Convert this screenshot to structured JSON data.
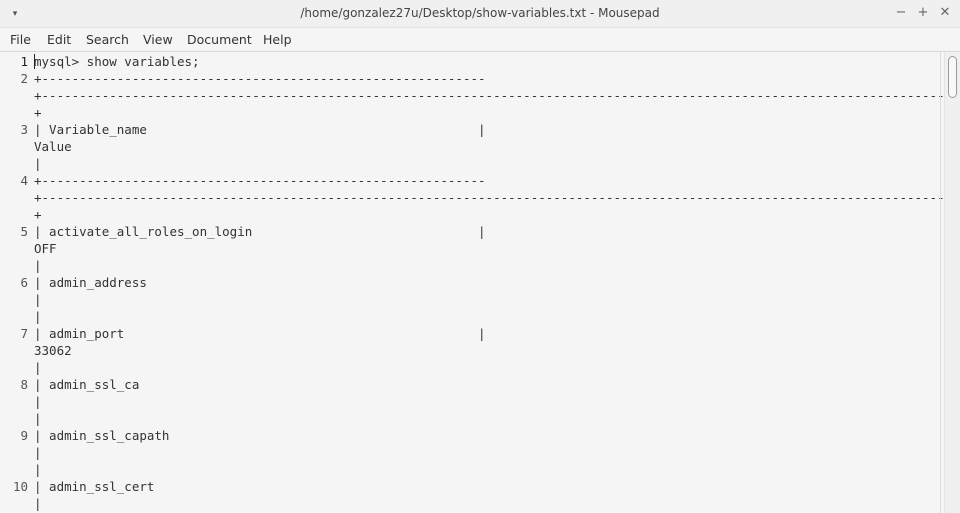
{
  "window": {
    "title": "/home/gonzalez27u/Desktop/show-variables.txt - Mousepad",
    "menu_glyph": "▾",
    "min_glyph": "−",
    "max_glyph": "+",
    "close_glyph": "✕"
  },
  "menu": {
    "file": "File",
    "edit": "Edit",
    "search": "Search",
    "view": "View",
    "document": "Document",
    "help": "Help"
  },
  "editor": {
    "line_numbers": [
      "1",
      "2",
      "3",
      "4",
      "5",
      "6",
      "7",
      "8",
      "9",
      "10"
    ],
    "rows": [
      "mysql> show variables;",
      "+-----------------------------------------------------------",
      "+--------------------------------------------------------------------------------------------------------------------------",
      "+",
      "| Variable_name                                            |",
      "Value",
      "|",
      "+-----------------------------------------------------------",
      "+--------------------------------------------------------------------------------------------------------------------------",
      "+",
      "| activate_all_roles_on_login                              |",
      "OFF",
      "|",
      "| admin_address",
      "|",
      "|",
      "| admin_port                                               |",
      "33062",
      "|",
      "| admin_ssl_ca",
      "|",
      "|",
      "| admin_ssl_capath",
      "|",
      "|",
      "| admin_ssl_cert",
      "|"
    ]
  }
}
